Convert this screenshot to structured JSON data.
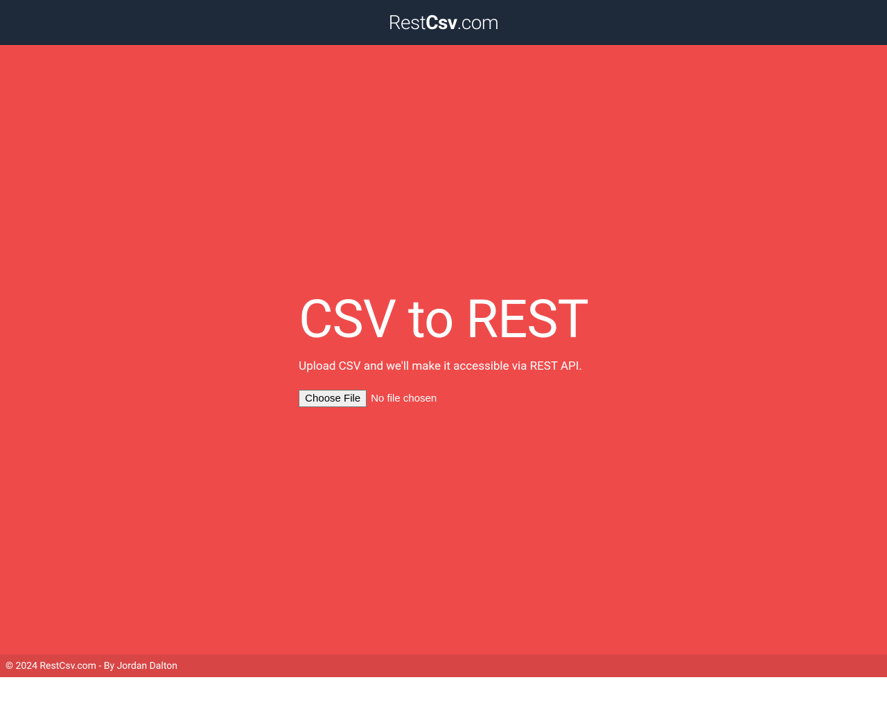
{
  "header": {
    "logo_part1": "Rest",
    "logo_part2": "Csv",
    "logo_part3": ".com"
  },
  "main": {
    "hero_title": "CSV to REST",
    "hero_subtitle": "Upload CSV and we'll make it accessible via REST API.",
    "choose_file_label": "Choose File",
    "file_status": "No file chosen"
  },
  "footer": {
    "copyright": "© 2024 RestCsv.com - By Jordan Dalton"
  }
}
